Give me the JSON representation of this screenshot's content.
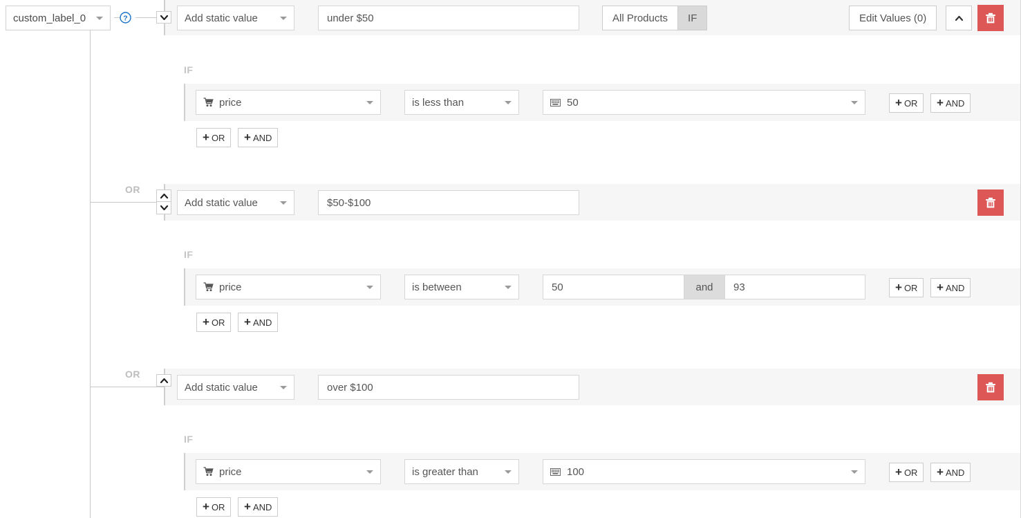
{
  "theme": {
    "accent_blue": "#1a73c8",
    "delete_red": "#dd5757",
    "band_gray": "#f6f6f6",
    "muted_gray": "#bdbdbd"
  },
  "attribute_selector": {
    "value": "custom_label_0",
    "help_icon": "help-circle-icon"
  },
  "header_actions": {
    "scope_all_label": "All Products",
    "scope_if_label": "IF",
    "scope_selected": "IF",
    "edit_values_label": "Edit Values (0)",
    "collapse_icon": "chevron-up-icon",
    "delete_icon": "trash-icon"
  },
  "labels": {
    "if": "IF",
    "or": "OR",
    "and": "and",
    "add_or": "OR",
    "add_and": "AND",
    "plus": "+"
  },
  "rules": [
    {
      "order_controls": [
        "chevron-down-icon"
      ],
      "or_badge": "",
      "value_source": "Add static value",
      "static_value": "under $50",
      "has_header_actions": true,
      "conditions": [
        {
          "field": "price",
          "field_icon": "shopping-cart-icon",
          "operator": "is less than",
          "value_icon": "keyboard-icon",
          "value": "50",
          "value2": null,
          "value_is_dropdown": true
        }
      ]
    },
    {
      "order_controls": [
        "chevron-up-icon",
        "chevron-down-icon"
      ],
      "or_badge": "OR",
      "value_source": "Add static value",
      "static_value": "$50-$100",
      "has_header_actions": false,
      "conditions": [
        {
          "field": "price",
          "field_icon": "shopping-cart-icon",
          "operator": "is between",
          "value_icon": null,
          "value": "50",
          "value2": "93",
          "value_is_dropdown": false
        }
      ]
    },
    {
      "order_controls": [
        "chevron-up-icon"
      ],
      "or_badge": "OR",
      "value_source": "Add static value",
      "static_value": "over $100",
      "has_header_actions": false,
      "conditions": [
        {
          "field": "price",
          "field_icon": "shopping-cart-icon",
          "operator": "is greater than",
          "value_icon": "keyboard-icon",
          "value": "100",
          "value2": null,
          "value_is_dropdown": true
        }
      ]
    }
  ]
}
